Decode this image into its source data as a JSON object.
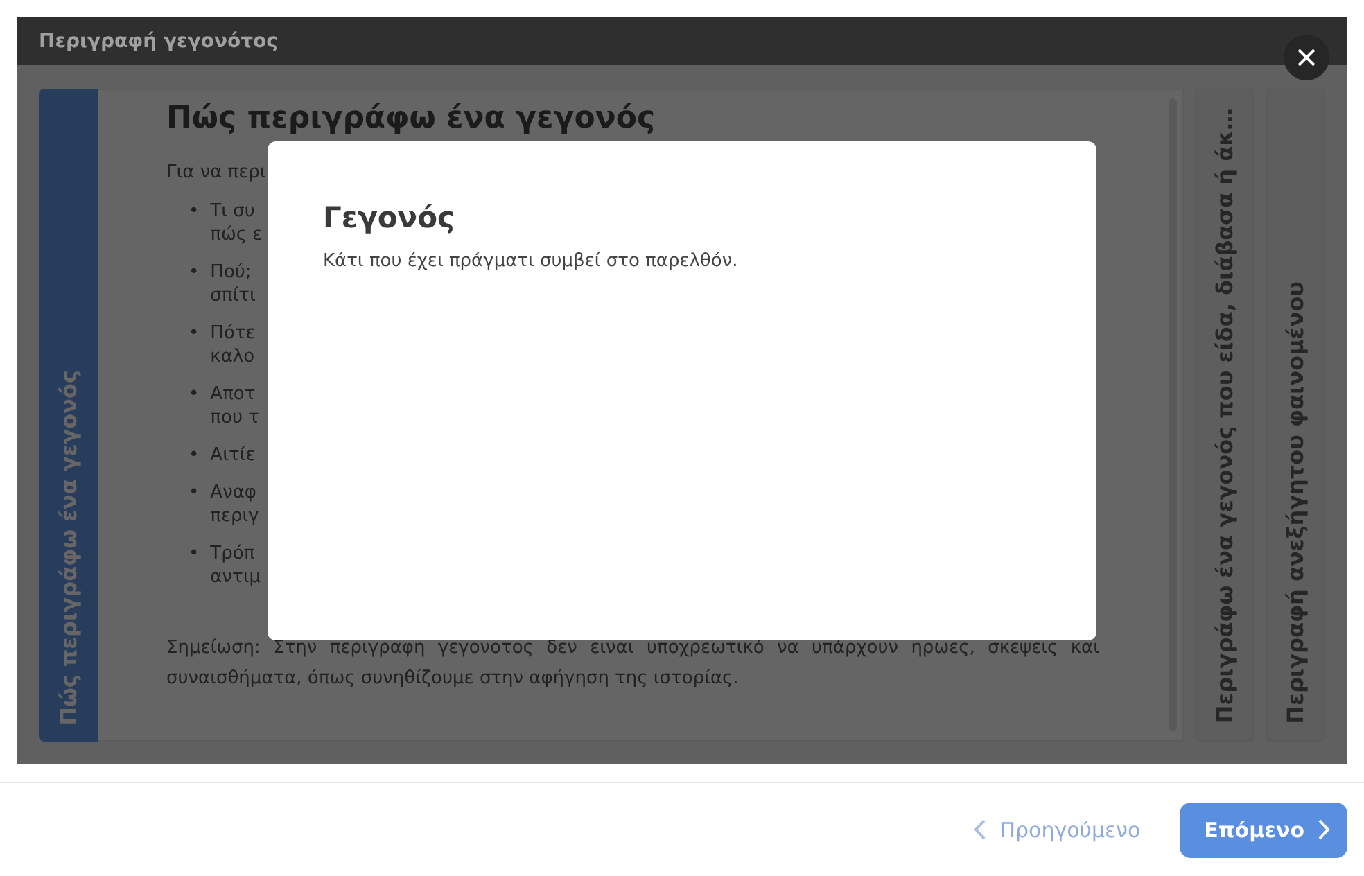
{
  "dialog": {
    "title": "Περιγραφή γεγονότος"
  },
  "sections": [
    {
      "title": "Πώς περιγράφω ένα γεγονός",
      "expanded": true
    },
    {
      "title": "Περιγράφω ένα γεγονός που είδα, διάβασα ή άκ…",
      "expanded": false
    },
    {
      "title": "Περιγραφή ανεξήγητου φαινομένου",
      "expanded": false
    }
  ],
  "article": {
    "heading": "Πώς περιγράφω ένα γεγονός",
    "intro": "Για να περι",
    "bullets": [
      {
        "marker": "•",
        "lines": [
          "Τι συ",
          "πώς ε"
        ]
      },
      {
        "marker": "•",
        "lines": [
          "Πού;",
          "σπίτι"
        ]
      },
      {
        "marker": "•",
        "lines": [
          "Πότε",
          "καλο"
        ]
      },
      {
        "marker": "•",
        "lines": [
          "Αποτ",
          "που τ"
        ]
      },
      {
        "marker": "•",
        "lines": [
          "Αιτίε"
        ]
      },
      {
        "marker": "•",
        "lines": [
          "Αναφ",
          "περιγ"
        ]
      },
      {
        "marker": "•",
        "lines": [
          "Τρόπ",
          "αντιμ"
        ]
      }
    ],
    "note": "Σημείωση: Στην περιγραφη γεγονοτος δεν ειναι υποχρεωτικό να υπάρχουν ηρωες, σκεψεις και συναισθήματα, όπως συνηθίζουμε στην αφήγηση της ιστορίας."
  },
  "popup": {
    "title": "Γεγονός",
    "text": "Κάτι που έχει πράγματι συμβεί στο παρελθόν."
  },
  "footer": {
    "previous": {
      "label": "Προηγούμενο",
      "disabled": true
    },
    "next": {
      "label": "Επόμενο",
      "disabled": false
    }
  }
}
